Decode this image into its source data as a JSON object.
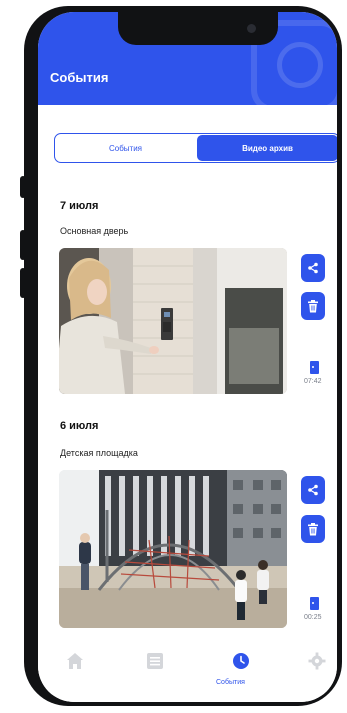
{
  "header": {
    "title": "События"
  },
  "segment": {
    "tab_events": "События",
    "tab_archive": "Видео архив",
    "active": "archive"
  },
  "events": [
    {
      "date": "7 июля",
      "place": "Основная дверь",
      "duration": "07:42"
    },
    {
      "date": "6 июля",
      "place": "Детская площадка",
      "duration": "00:25"
    }
  ],
  "tabbar": {
    "home_icon": "home-icon",
    "list_icon": "list-icon",
    "events_label": "События",
    "settings_icon": "gear-icon"
  },
  "colors": {
    "accent": "#2f54eb",
    "inactive_icon": "#d4d6da",
    "phone_frame": "#111214"
  }
}
